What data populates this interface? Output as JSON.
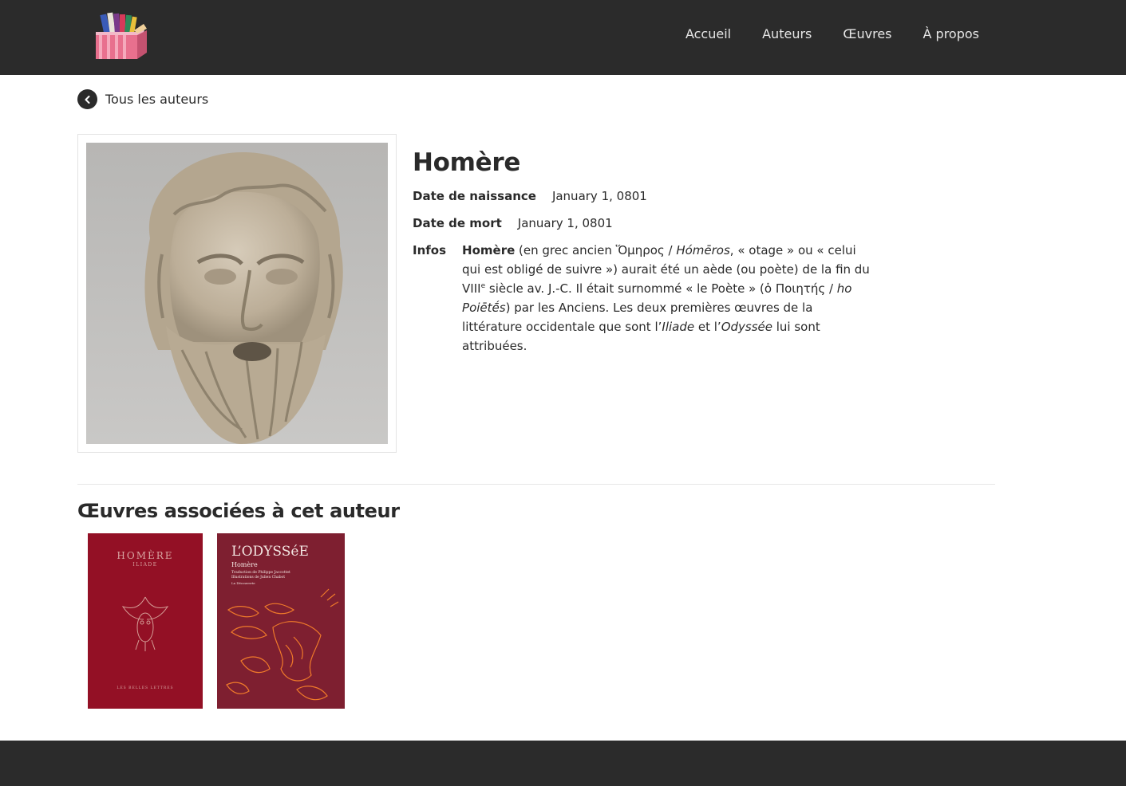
{
  "nav": {
    "logo_icon": "books-box-logo-icon",
    "links": [
      "Accueil",
      "Auteurs",
      "Œuvres",
      "À propos"
    ]
  },
  "back": {
    "icon": "chevron-left-icon",
    "label": "Tous les auteurs"
  },
  "author": {
    "name": "Homère",
    "birth_label": "Date de naissance",
    "birth_value": "January 1, 0801",
    "death_label": "Date de mort",
    "death_value": "January 1, 0801",
    "info_label": "Infos",
    "info": {
      "name_bold": "Homère",
      "t1": " (en grec ancien Ὅμηρος / ",
      "i1": "Hómēros",
      "t2": ", « otage » ou « celui qui est obligé de suivre ») aurait été un aède (ou poète) de la fin du VIII",
      "sup": "e",
      "t3": " siècle av. J.-C. Il était surnommé « le Poète » (ὁ Ποιητής / ",
      "i2": "ho Poiētḗs",
      "t4": ") par les Anciens. Les deux premières œuvres de la littérature occidentale que sont l’",
      "i3": "Iliade",
      "t5": " et l’",
      "i4": "Odyssée",
      "t6": " lui sont attribuées."
    }
  },
  "works": {
    "heading": "Œuvres associées à cet auteur",
    "books": [
      {
        "author": "HOMÈRE",
        "title": "ILIADE",
        "publisher": "LES BELLES LETTRES",
        "color": "#8c0f22"
      },
      {
        "title": "L’ODYSSéE",
        "author": "Homère",
        "credits_1": "Traduction de Philippe Jaccottet",
        "credits_2": "Illustrations de Julien Chabot",
        "publisher": "La Découverte",
        "color": "#7e1f30"
      }
    ]
  },
  "colors": {
    "navbar": "#2b2b2b",
    "footer": "#2b2b2b",
    "text": "#2a2a2a"
  }
}
